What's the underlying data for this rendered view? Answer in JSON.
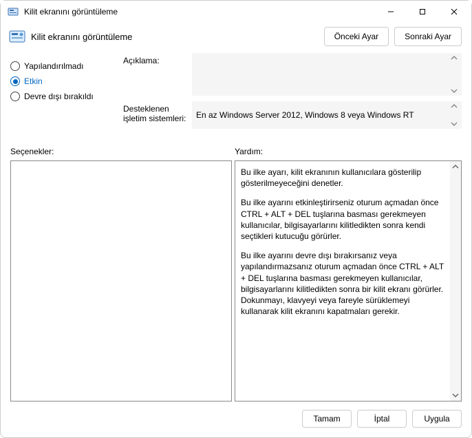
{
  "window": {
    "title": "Kilit ekranını görüntüleme",
    "minimize": "—",
    "maximize": "□",
    "close": "×"
  },
  "header": {
    "title": "Kilit ekranını görüntüleme",
    "prev_label": "Önceki Ayar",
    "next_label": "Sonraki Ayar"
  },
  "radios": {
    "not_configured": "Yapılandırılmadı",
    "enabled": "Etkin",
    "disabled": "Devre dışı bırakıldı",
    "selected": "enabled"
  },
  "info": {
    "desc_label": "Açıklama:",
    "desc_value": "",
    "os_label": "Desteklenen işletim sistemleri:",
    "os_value": "En az Windows Server 2012, Windows 8 veya Windows RT"
  },
  "section_labels": {
    "options": "Seçenekler:",
    "help": "Yardım:"
  },
  "help": {
    "p1": "Bu ilke ayarı, kilit ekranının kullanıcılara gösterilip gösterilmeyeceğini denetler.",
    "p2": "Bu ilke ayarını etkinleştirirseniz oturum açmadan önce CTRL + ALT + DEL tuşlarına basması gerekmeyen kullanıcılar, bilgisayarlarını kilitledikten sonra kendi seçtikleri kutucuğu görürler.",
    "p3": "Bu ilke ayarını devre dışı bırakırsanız veya yapılandırmazsanız oturum açmadan önce CTRL + ALT + DEL tuşlarına basması gerekmeyen kullanıcılar, bilgisayarlarını kilitledikten sonra bir kilit ekranı görürler. Dokunmayı, klavyeyi veya fareyle sürüklemeyi kullanarak kilit ekranını kapatmaları gerekir."
  },
  "footer": {
    "ok": "Tamam",
    "cancel": "İptal",
    "apply": "Uygula"
  }
}
